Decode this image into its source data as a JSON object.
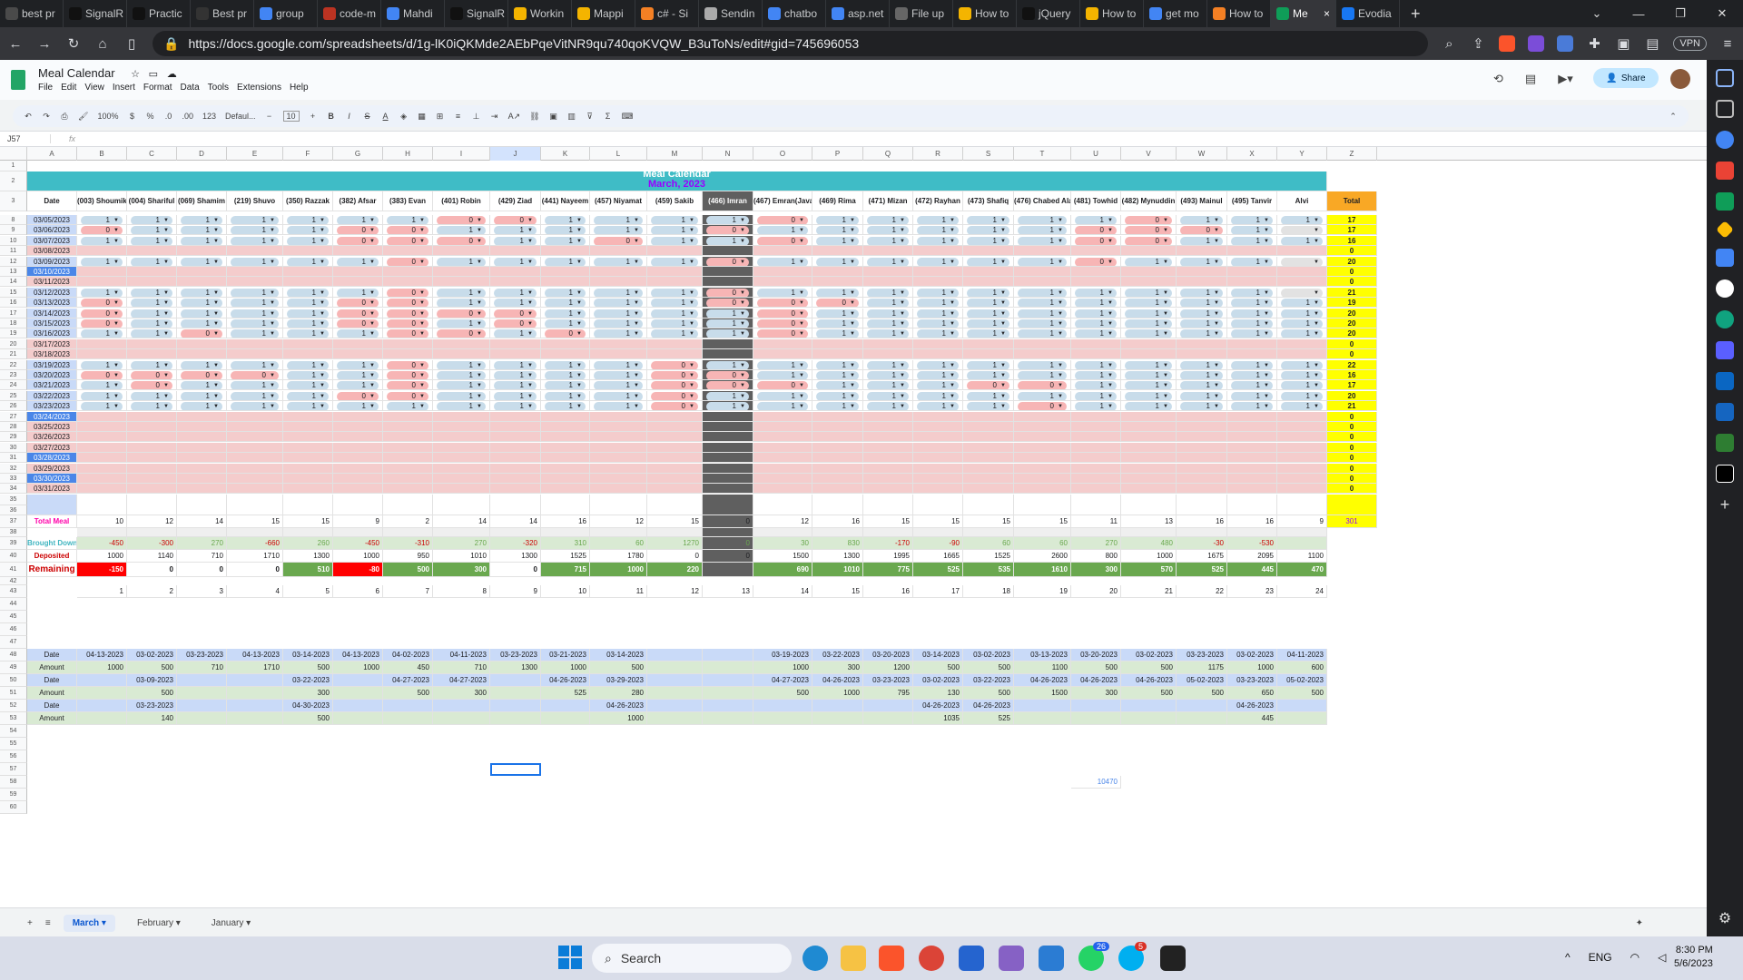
{
  "browser": {
    "tabs": [
      "best pr",
      "SignalR",
      "Practic",
      "Best pr",
      "group",
      "code-m",
      "Mahdi",
      "SignalR",
      "Workin",
      "Mappi",
      "c# - Si",
      "Sendin",
      "chatbo",
      "asp.net",
      "File up",
      "How to",
      "jQuery",
      "How to",
      "get mo",
      "How to",
      "Me",
      "Evodia"
    ],
    "active_tab": 20,
    "url": "https://docs.google.com/spreadsheets/d/1g-lK0iQKMde2AEbPqeVitNR9qu740qoKVQW_B3uToNs/edit#gid=745696053",
    "vpn_label": "VPN"
  },
  "doc": {
    "title": "Meal Calendar",
    "menu": [
      "File",
      "Edit",
      "View",
      "Insert",
      "Format",
      "Data",
      "Tools",
      "Extensions",
      "Help"
    ],
    "share": "Share",
    "zoom": "100%",
    "font": "Defaul...",
    "font_size": "10",
    "cell_ref": "J57",
    "fx": "fx"
  },
  "sheet": {
    "banner_title": "Meal Calendar",
    "banner_sub": "March, 2023",
    "colors": {
      "teal": "#3fbcc6",
      "pink": "#f4cccc",
      "blue_date": "#4a86e8",
      "grey": "#5f5f5f",
      "yellow": "#ffff00",
      "orange": "#f9a825",
      "green": "#6aa84f",
      "red": "#ff0000",
      "lightgreen": "#d9ead3",
      "lightblue": "#cfe2f3"
    },
    "col_letters": [
      "A",
      "B",
      "C",
      "D",
      "E",
      "F",
      "G",
      "H",
      "I",
      "J",
      "K",
      "L",
      "M",
      "N",
      "O",
      "P",
      "Q",
      "R",
      "S",
      "T",
      "U",
      "V",
      "W",
      "X",
      "Y",
      "Z"
    ],
    "members": [
      "(003) Shoumik",
      "(004) Shariful",
      "(069) Shamim",
      "(219) Shuvo",
      "(350) Razzak",
      "(382) Afsar",
      "(383) Evan",
      "(401) Robin",
      "(429) Ziad",
      "(441) Nayeem",
      "(457) Niyamat",
      "(459) Sakib",
      "(466) Imran",
      "(467) Emran(Java)",
      "(469) Rima",
      "(471) Mizan",
      "(472) Rayhan",
      "(473) Shafiq",
      "(476) Chabed Alam",
      "(481) Towhid",
      "(482) Mynuddin",
      "(493) Mainul",
      "(495) Tanvir",
      "Alvi"
    ],
    "date_header": "Date",
    "total_header": "Total",
    "rows": [
      {
        "n": "8",
        "date": "03/05/2023",
        "v": "1111111001111011111101111B",
        "total": "17"
      },
      {
        "n": "9",
        "date": "03/06/2023",
        "v": "01111001111101111110001B",
        "total": "17"
      },
      {
        "n": "10",
        "date": "03/07/2023",
        "v": "111110001101101111100111B",
        "total": "16"
      },
      {
        "n": "11",
        "date": "03/08/2023",
        "v": "",
        "total": "0"
      },
      {
        "n": "12",
        "date": "03/09/2023",
        "v": "11111101111101111110111B",
        "total": "20"
      },
      {
        "n": "13",
        "date": "03/10/2023",
        "v": "",
        "total": "0"
      },
      {
        "n": "14",
        "date": "03/11/2023",
        "v": "",
        "total": "0"
      },
      {
        "n": "15",
        "date": "03/12/2023",
        "v": "11111101111101111111111B",
        "total": "21"
      },
      {
        "n": "16",
        "date": "03/13/2023",
        "v": "011110011111000111111111",
        "total": "19"
      },
      {
        "n": "17",
        "date": "03/14/2023",
        "v": "011110000111101111111111",
        "total": "20"
      },
      {
        "n": "18",
        "date": "03/15/2023",
        "v": "011110010111101111111111",
        "total": "20"
      },
      {
        "n": "19",
        "date": "03/16/2023",
        "v": "110111001011101111111111",
        "total": "20"
      },
      {
        "n": "20",
        "date": "03/17/2023",
        "v": "",
        "total": "0"
      },
      {
        "n": "21",
        "date": "03/18/2023",
        "v": "",
        "total": "0"
      },
      {
        "n": "22",
        "date": "03/19/2023",
        "v": "111111011110111111111111",
        "total": "22"
      },
      {
        "n": "23",
        "date": "03/20/2023",
        "v": "000011011110011111111111",
        "total": "16"
      },
      {
        "n": "24",
        "date": "03/21/2023",
        "v": "101111011110001110011111",
        "total": "17"
      },
      {
        "n": "25",
        "date": "03/22/2023",
        "v": "111110011110111111111111",
        "total": "20"
      },
      {
        "n": "26",
        "date": "03/23/2023",
        "v": "111111111110111111011111",
        "total": "21"
      },
      {
        "n": "27",
        "date": "03/24/2023",
        "v": "",
        "total": "0"
      },
      {
        "n": "28",
        "date": "03/25/2023",
        "v": "",
        "total": "0"
      },
      {
        "n": "29",
        "date": "03/26/2023",
        "v": "",
        "total": "0"
      },
      {
        "n": "30",
        "date": "03/27/2023",
        "v": "",
        "total": "0"
      },
      {
        "n": "31",
        "date": "03/28/2023",
        "v": "",
        "total": "0"
      },
      {
        "n": "32",
        "date": "03/29/2023",
        "v": "",
        "total": "0"
      },
      {
        "n": "33",
        "date": "03/30/2023",
        "v": "",
        "total": "0"
      },
      {
        "n": "34",
        "date": "03/31/2023",
        "v": "",
        "total": "0"
      }
    ],
    "total_meal_label": "Total Meal",
    "total_meal": [
      "10",
      "12",
      "14",
      "15",
      "15",
      "9",
      "2",
      "14",
      "14",
      "16",
      "12",
      "15",
      "0",
      "12",
      "16",
      "15",
      "15",
      "15",
      "15",
      "11",
      "13",
      "16",
      "16",
      "9"
    ],
    "total_meal_sum": "301",
    "brought_down_label": "Brought Down",
    "brought_down": [
      "-450",
      "-300",
      "270",
      "-660",
      "260",
      "-450",
      "-310",
      "270",
      "-320",
      "310",
      "60",
      "1270",
      "0",
      "30",
      "830",
      "-170",
      "-90",
      "60",
      "60",
      "270",
      "480",
      "-30",
      "-530",
      ""
    ],
    "deposited_label": "Deposited",
    "deposited": [
      "1000",
      "1140",
      "710",
      "1710",
      "1300",
      "1000",
      "950",
      "1010",
      "1300",
      "1525",
      "1780",
      "0",
      "0",
      "1500",
      "1300",
      "1995",
      "1665",
      "1525",
      "2600",
      "800",
      "1000",
      "1675",
      "2095",
      "1100"
    ],
    "remaining_label": "Remaining",
    "remaining": [
      "-150",
      "0",
      "0",
      "0",
      "510",
      "-80",
      "500",
      "300",
      "0",
      "715",
      "1000",
      "220",
      "",
      "690",
      "1010",
      "775",
      "525",
      "535",
      "1610",
      "300",
      "570",
      "525",
      "445",
      "470"
    ],
    "index_row": [
      "1",
      "2",
      "3",
      "4",
      "5",
      "6",
      "7",
      "8",
      "9",
      "10",
      "11",
      "12",
      "13",
      "14",
      "15",
      "16",
      "17",
      "18",
      "19",
      "20",
      "21",
      "22",
      "23",
      "24"
    ],
    "hist_labels": [
      "Date",
      "Amount",
      "Date",
      "Amount",
      "Date",
      "Amount"
    ],
    "hist": [
      [
        "04-13-2023",
        "03-02-2023",
        "03-23-2023",
        "04-13-2023",
        "03-14-2023",
        "04-13-2023",
        "04-02-2023",
        "04-11-2023",
        "03-23-2023",
        "03-21-2023",
        "03-14-2023",
        "",
        "",
        "03-19-2023",
        "03-22-2023",
        "03-20-2023",
        "03-14-2023",
        "03-02-2023",
        "03-13-2023",
        "03-20-2023",
        "03-02-2023",
        "03-23-2023",
        "03-02-2023",
        "04-11-2023"
      ],
      [
        "1000",
        "500",
        "710",
        "1710",
        "500",
        "1000",
        "450",
        "710",
        "1300",
        "1000",
        "500",
        "",
        "",
        "1000",
        "300",
        "1200",
        "500",
        "500",
        "1100",
        "500",
        "500",
        "1175",
        "1000",
        "600"
      ],
      [
        "",
        "03-09-2023",
        "",
        "",
        "03-22-2023",
        "",
        "04-27-2023",
        "04-27-2023",
        "",
        "04-26-2023",
        "03-29-2023",
        "",
        "",
        "04-27-2023",
        "04-26-2023",
        "03-23-2023",
        "03-02-2023",
        "03-22-2023",
        "04-26-2023",
        "04-26-2023",
        "04-26-2023",
        "05-02-2023",
        "03-23-2023",
        "05-02-2023"
      ],
      [
        "",
        "500",
        "",
        "",
        "300",
        "",
        "500",
        "300",
        "",
        "525",
        "280",
        "",
        "",
        "500",
        "1000",
        "795",
        "130",
        "500",
        "1500",
        "300",
        "500",
        "500",
        "650",
        "500"
      ],
      [
        "",
        "03-23-2023",
        "",
        "",
        "04-30-2023",
        "",
        "",
        "",
        "",
        "",
        "04-26-2023",
        "",
        "",
        "",
        "",
        "",
        "04-26-2023",
        "04-26-2023",
        "",
        "",
        "",
        "",
        "04-26-2023",
        ""
      ],
      [
        "",
        "140",
        "",
        "",
        "500",
        "",
        "",
        "",
        "",
        "",
        "1000",
        "",
        "",
        "",
        "",
        "",
        "1035",
        "525",
        "",
        "",
        "",
        "",
        "445",
        ""
      ]
    ],
    "stray_value": "10470",
    "row_nums_top": [
      "1",
      "2",
      "3"
    ],
    "row_nums_bottom": [
      "35",
      "36",
      "37",
      "38",
      "39",
      "40",
      "41",
      "42",
      "43",
      "44",
      "45",
      "46",
      "47",
      "48",
      "49",
      "50",
      "51",
      "52",
      "53",
      "54",
      "55",
      "56",
      "57",
      "58",
      "59",
      "60"
    ]
  },
  "sheet_tabs": [
    "March",
    "February",
    "January"
  ],
  "taskbar": {
    "search": "Search",
    "lang": "ENG",
    "time": "8:30 PM",
    "date": "5/6/2023",
    "badge1": "26",
    "badge2": "5"
  }
}
